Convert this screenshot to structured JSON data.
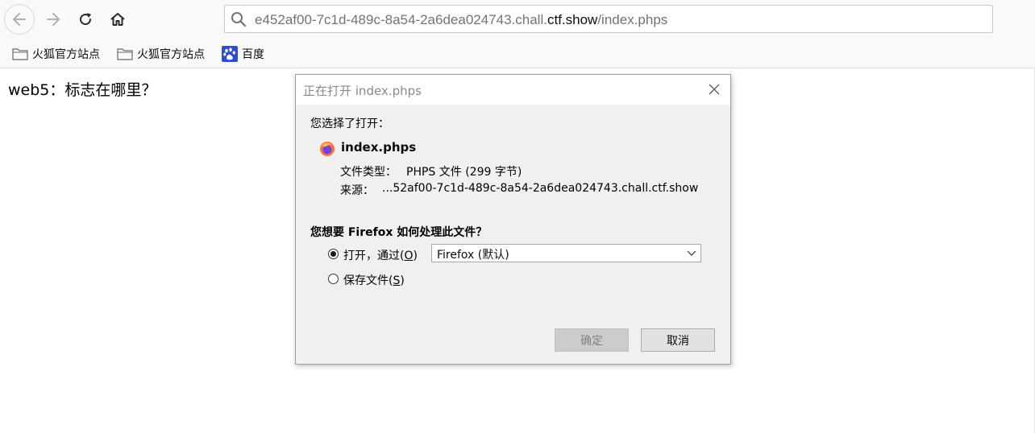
{
  "browser": {
    "url_prefix": "e452af00-7c1d-489c-8a54-2a6dea024743.chall.",
    "url_domain": "ctf.show",
    "url_path": "/index.phps",
    "bookmarks": [
      {
        "label": "火狐官方站点",
        "icon": "folder-icon"
      },
      {
        "label": "火狐官方站点",
        "icon": "folder-icon"
      },
      {
        "label": "百度",
        "icon": "baidu-paw-icon"
      }
    ]
  },
  "page": {
    "heading": "web5：标志在哪里？"
  },
  "dialog": {
    "title": "正在打开 index.phps",
    "you_chose": "您选择了打开：",
    "filename": "index.phps",
    "file_type_label": "文件类型：",
    "file_type_value": "PHPS 文件 (299 字节)",
    "source_label": "来源：",
    "source_value": "...52af00-7c1d-489c-8a54-2a6dea024743.chall.ctf.show",
    "question": "您想要 Firefox 如何处理此文件？",
    "open_with_label": "打开，通过(",
    "open_with_key": "O",
    "open_with_end": ")",
    "open_with_selected": true,
    "app_select_value": "Firefox (默认)",
    "save_file_label": "保存文件(",
    "save_file_key": "S",
    "save_file_end": ")",
    "save_file_selected": false,
    "ok_button": "确定",
    "cancel_button": "取消"
  }
}
